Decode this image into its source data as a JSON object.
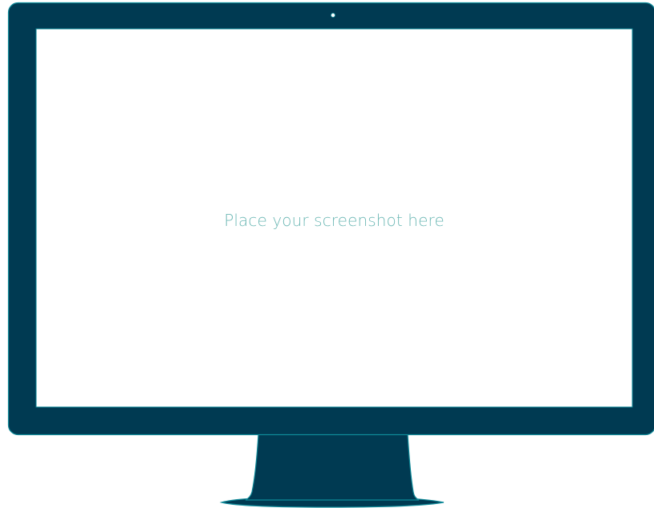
{
  "screen": {
    "placeholder_text": "Place your screenshot here"
  },
  "icons": {
    "camera": "webcam-dot-icon"
  },
  "colors": {
    "frame": "#003a52",
    "frame_edge": "#0e8a99",
    "screen": "#ffffff",
    "placeholder_text": "#6fb9b6",
    "camera": "#ffffff"
  }
}
